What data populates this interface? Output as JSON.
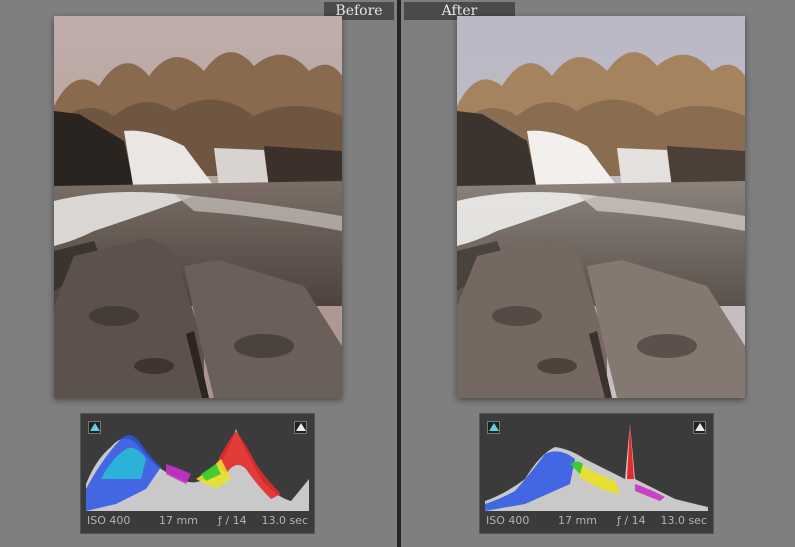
{
  "before": {
    "label": "Before",
    "photo_icon": "waterfall-photo",
    "histogram": {
      "iso": "ISO 400",
      "focal_length": "17 mm",
      "aperture": "ƒ / 14",
      "shutter": "13.0 sec"
    }
  },
  "after": {
    "label": "After",
    "photo_icon": "waterfall-photo",
    "histogram": {
      "iso": "ISO 400",
      "focal_length": "17 mm",
      "aperture": "ƒ / 14",
      "shutter": "13.0 sec"
    }
  },
  "colors": {
    "background": "#7f7f7f",
    "divider": "#262626",
    "tab": "#4a4a4a",
    "histogram_bg": "#3b3b3b",
    "shadow_clip_icon": "#5fd0e0",
    "highlight_clip_icon": "#eaeaea"
  }
}
